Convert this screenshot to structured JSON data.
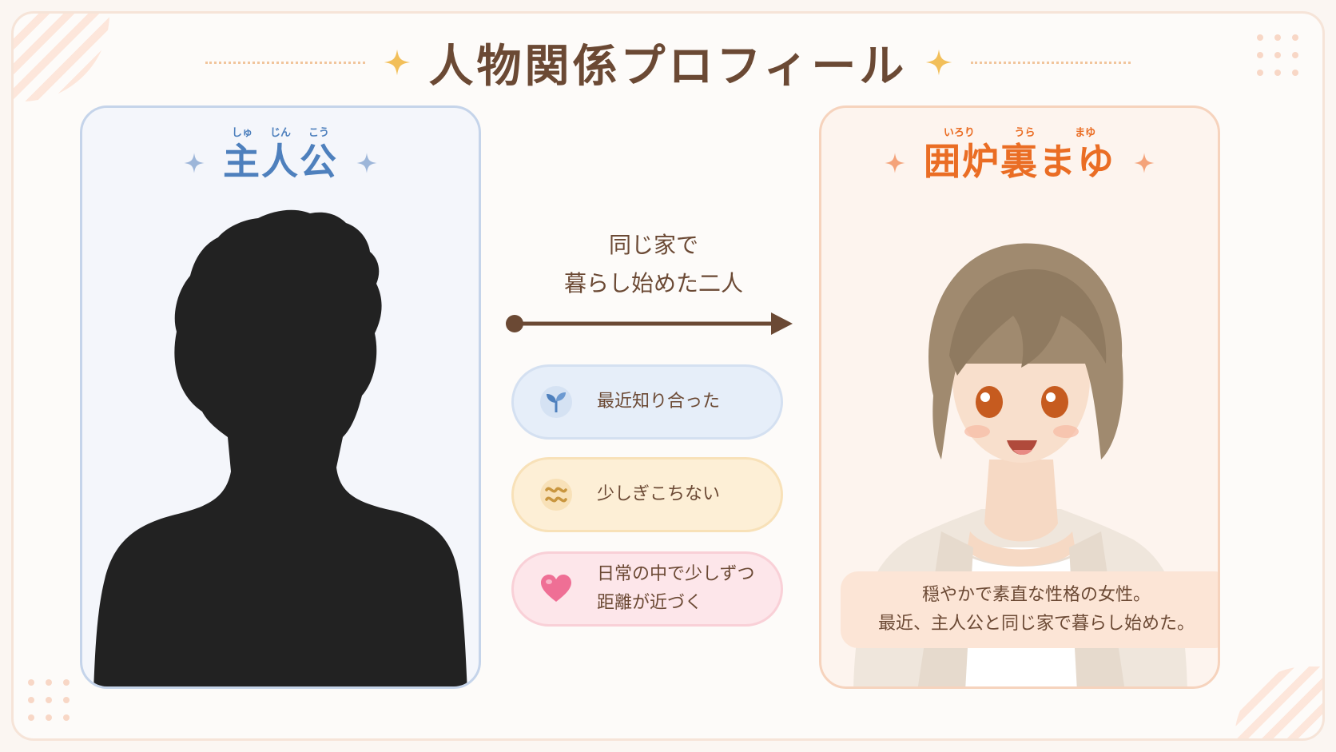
{
  "title": "人物関係プロフィール",
  "protagonist": {
    "ruby": [
      "しゅ",
      "じん",
      "こう"
    ],
    "name": "主人公"
  },
  "heroine": {
    "ruby": [
      "いろり",
      "うら",
      "まゆ"
    ],
    "name": "囲炉裏まゆ",
    "description_lines": [
      "穏やかで素直な性格の女性。",
      "最近、主人公と同じ家で暮らし始めた。"
    ]
  },
  "relation": {
    "lines": [
      "同じ家で",
      "暮らし始めた二人"
    ]
  },
  "status_pills": [
    {
      "icon": "sprout-icon",
      "lines": [
        "最近知り合った"
      ]
    },
    {
      "icon": "wavy-awkward-icon",
      "lines": [
        "少しぎこちない"
      ]
    },
    {
      "icon": "heart-icon",
      "lines": [
        "日常の中で少しずつ",
        "距離が近づく"
      ]
    }
  ],
  "colors": {
    "brown_text": "#6b4934",
    "protagonist_blue": "#4e80bd",
    "heroine_orange": "#ea6d24",
    "gold_sparkle": "#f2bf5a"
  }
}
